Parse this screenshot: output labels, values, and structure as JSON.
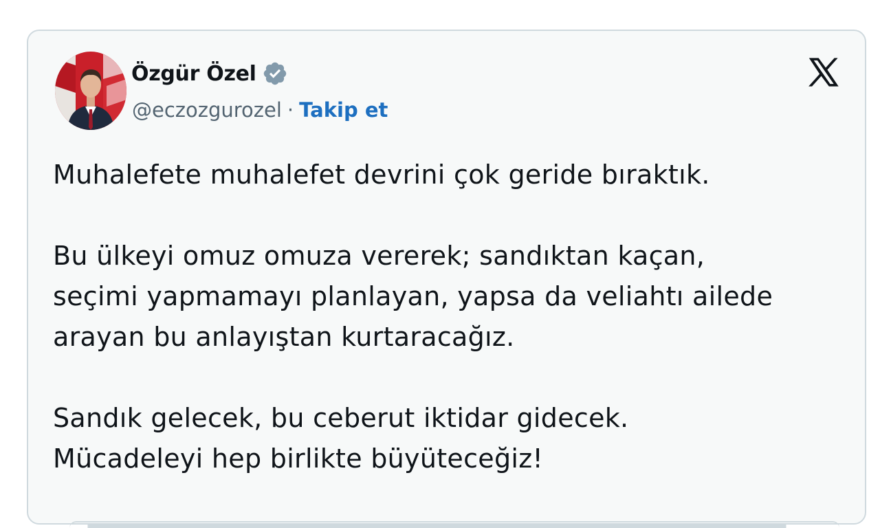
{
  "author": {
    "name": "Özgür Özel",
    "handle": "@eczozgurozel",
    "separator": "·",
    "follow_label": "Takip et",
    "verified": true,
    "avatar_icon": "profile-photo"
  },
  "platform": {
    "logo_icon": "x-logo-icon"
  },
  "tweet": {
    "paragraphs": [
      "Muhalefete muhalefet devrini çok geride bıraktık.",
      "Bu ülkeyi omuz omuza vererek; sandıktan kaçan,\nseçimi yapmamayı planlayan, yapsa da veliahtı ailede\narayan bu anlayıştan kurtaracağız.",
      "Sandık gelecek, bu ceberut iktidar gidecek.\nMücadeleyi hep birlikte büyüteceğiz!"
    ]
  },
  "colors": {
    "card_background": "#f7f9f9",
    "card_border": "#cfd9de",
    "link": "#1d6fc0",
    "text": "#0f1419",
    "muted": "#536471"
  }
}
